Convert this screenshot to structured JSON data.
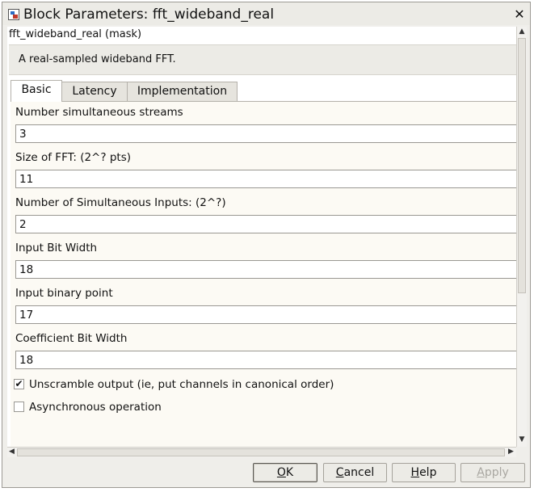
{
  "window": {
    "title": "Block Parameters: fft_wideband_real",
    "close_symbol": "✕"
  },
  "mask": {
    "title": "fft_wideband_real (mask)",
    "description": "A real-sampled wideband FFT."
  },
  "tabs": [
    {
      "label": "Basic",
      "active": true
    },
    {
      "label": "Latency",
      "active": false
    },
    {
      "label": "Implementation",
      "active": false
    }
  ],
  "fields": [
    {
      "label": "Number simultaneous streams",
      "value": "3"
    },
    {
      "label": "Size of FFT: (2^? pts)",
      "value": "11"
    },
    {
      "label": "Number of Simultaneous Inputs: (2^?)",
      "value": "2"
    },
    {
      "label": "Input Bit Width",
      "value": "18"
    },
    {
      "label": "Input binary point",
      "value": "17"
    },
    {
      "label": "Coefficient Bit Width",
      "value": "18"
    }
  ],
  "checkboxes": [
    {
      "label": "Unscramble output (ie, put channels in canonical order)",
      "checked": true
    },
    {
      "label": "Asynchronous operation",
      "checked": false
    }
  ],
  "scroll": {
    "up": "▲",
    "down": "▼",
    "left": "◀",
    "right": "▶"
  },
  "buttons": {
    "ok": {
      "mnemonic": "O",
      "rest": "K"
    },
    "cancel": {
      "mnemonic": "C",
      "rest": "ancel"
    },
    "help": {
      "mnemonic": "H",
      "rest": "elp"
    },
    "apply": {
      "mnemonic": "A",
      "rest": "pply",
      "disabled": true
    }
  },
  "icons": {
    "app": "simulink-block-icon",
    "close": "close-icon"
  }
}
